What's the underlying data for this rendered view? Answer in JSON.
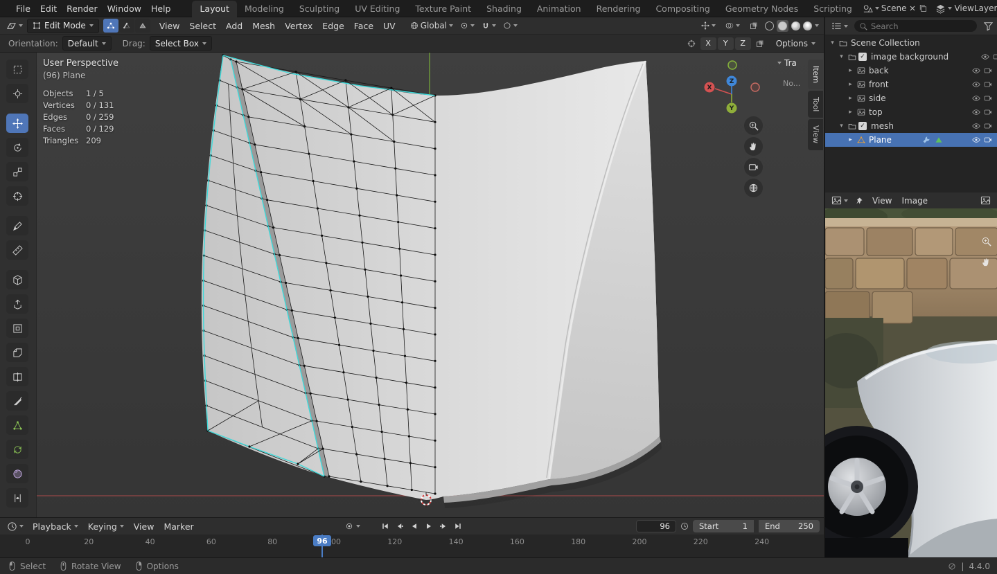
{
  "topbar": {
    "menus": [
      "File",
      "Edit",
      "Render",
      "Window",
      "Help"
    ],
    "tabs": [
      {
        "label": "Layout",
        "active": true
      },
      {
        "label": "Modeling"
      },
      {
        "label": "Sculpting"
      },
      {
        "label": "UV Editing"
      },
      {
        "label": "Texture Paint"
      },
      {
        "label": "Shading"
      },
      {
        "label": "Animation"
      },
      {
        "label": "Rendering"
      },
      {
        "label": "Compositing"
      },
      {
        "label": "Geometry Nodes"
      },
      {
        "label": "Scripting"
      }
    ],
    "scene": {
      "label": "Scene"
    },
    "viewlayer": {
      "label": "ViewLayer"
    }
  },
  "viewport_header": {
    "mode_label": "Edit Mode",
    "menus": [
      "View",
      "Select",
      "Add",
      "Mesh",
      "Vertex",
      "Edge",
      "Face",
      "UV"
    ],
    "orientation_label": "Global"
  },
  "tool_settings": {
    "orientation_label": "Orientation:",
    "orientation_value": "Default",
    "drag_label": "Drag:",
    "drag_value": "Select Box",
    "axes": [
      {
        "label": "X"
      },
      {
        "label": "Y"
      },
      {
        "label": "Z"
      }
    ],
    "options_label": "Options"
  },
  "toolbar": {
    "tools": [
      {
        "name": "Select Box",
        "glyph": "box"
      },
      {
        "name": "Cursor",
        "glyph": "cursor"
      },
      {
        "name": "Move",
        "glyph": "move",
        "active": true,
        "gap": true
      },
      {
        "name": "Rotate",
        "glyph": "rotate"
      },
      {
        "name": "Scale",
        "glyph": "scale"
      },
      {
        "name": "Transform",
        "glyph": "transform"
      },
      {
        "name": "Annotate",
        "glyph": "pen",
        "gap": true
      },
      {
        "name": "Measure",
        "glyph": "measure"
      },
      {
        "name": "Add Cube",
        "glyph": "cube",
        "gap": true
      },
      {
        "name": "Extrude Region",
        "glyph": "extrude"
      },
      {
        "name": "Inset Faces",
        "glyph": "inset"
      },
      {
        "name": "Bevel",
        "glyph": "bevel"
      },
      {
        "name": "Loop Cut",
        "glyph": "loopcut"
      },
      {
        "name": "Knife",
        "glyph": "knife"
      },
      {
        "name": "Poly Build",
        "glyph": "polybuild",
        "tint": "#8cc455"
      },
      {
        "name": "Spin",
        "glyph": "spin",
        "tint": "#8cc455"
      },
      {
        "name": "Smooth",
        "glyph": "smooth",
        "tint": "#c3a9e2"
      },
      {
        "name": "Edge Slide",
        "glyph": "slide"
      }
    ]
  },
  "viewport": {
    "overlay": {
      "view_label": "User Perspective",
      "object_label": "(96) Plane",
      "stats": [
        {
          "label": "Objects",
          "value": "1 / 5"
        },
        {
          "label": "Vertices",
          "value": "0 / 131"
        },
        {
          "label": "Edges",
          "value": "0 / 259"
        },
        {
          "label": "Faces",
          "value": "0 / 129"
        },
        {
          "label": "Triangles",
          "value": "209"
        }
      ]
    },
    "gizmo": {
      "x": "X",
      "y": "Y",
      "z": "Z"
    },
    "sidebar_tabs": [
      {
        "label": "Item",
        "active": true
      },
      {
        "label": "Tool"
      },
      {
        "label": "View"
      }
    ],
    "npanel": {
      "section": "Tra",
      "hint": "No..."
    }
  },
  "outliner": {
    "search_placeholder": "Search",
    "rows": [
      {
        "label": "Scene Collection",
        "depth": 0,
        "disclosure": "down",
        "icon": "collection",
        "icon_color": "#d0d0d0"
      },
      {
        "label": "image background",
        "depth": 1,
        "disclosure": "down",
        "icon": "collection",
        "icon_color": "#d0d0d0",
        "checkbox": true,
        "eye": true,
        "camera": true
      },
      {
        "label": "back",
        "depth": 2,
        "disclosure": "right",
        "icon": "image",
        "icon_color": "#b5b5b5",
        "eye": true,
        "camera": true
      },
      {
        "label": "front",
        "depth": 2,
        "disclosure": "right",
        "icon": "image",
        "icon_color": "#b5b5b5",
        "eye": true,
        "camera": true
      },
      {
        "label": "side",
        "depth": 2,
        "disclosure": "right",
        "icon": "image",
        "icon_color": "#b5b5b5",
        "eye": true,
        "camera": true
      },
      {
        "label": "top",
        "depth": 2,
        "disclosure": "right",
        "icon": "image",
        "icon_color": "#b5b5b5",
        "eye": true,
        "camera": true
      },
      {
        "label": "mesh",
        "depth": 1,
        "disclosure": "down",
        "icon": "collection",
        "icon_color": "#d0d0d0",
        "checkbox": true,
        "eye": true,
        "camera": true
      },
      {
        "label": "Plane",
        "depth": 2,
        "disclosure": "right",
        "icon": "meshdata",
        "icon_color": "#eba23b",
        "selected": true,
        "eye": true,
        "camera": true,
        "badges": [
          {
            "icon": "wrench",
            "color": "#9ec3ea",
            "name": "modifier-icon"
          },
          {
            "icon": "tri",
            "color": "#5fc05f",
            "name": "mesh-data-icon"
          }
        ]
      }
    ]
  },
  "image_editor": {
    "menus": [
      "View",
      "Image"
    ]
  },
  "timeline": {
    "menus": [
      {
        "label": "Playback",
        "caret": true
      },
      {
        "label": "Keying",
        "caret": true
      },
      {
        "label": "View"
      },
      {
        "label": "Marker"
      }
    ],
    "current_frame": "96",
    "start_label": "Start",
    "start_value": "1",
    "end_label": "End",
    "end_value": "250",
    "ticks": [
      "0",
      "20",
      "40",
      "60",
      "80",
      "100",
      "120",
      "140",
      "160",
      "180",
      "200",
      "220",
      "240"
    ]
  },
  "statusbar": {
    "items": [
      {
        "label": "Select",
        "icon": "mouse-l"
      },
      {
        "label": "Rotate View",
        "icon": "mouse-m"
      },
      {
        "label": "Options",
        "icon": "mouse-r"
      }
    ],
    "version": "4.4.0"
  }
}
